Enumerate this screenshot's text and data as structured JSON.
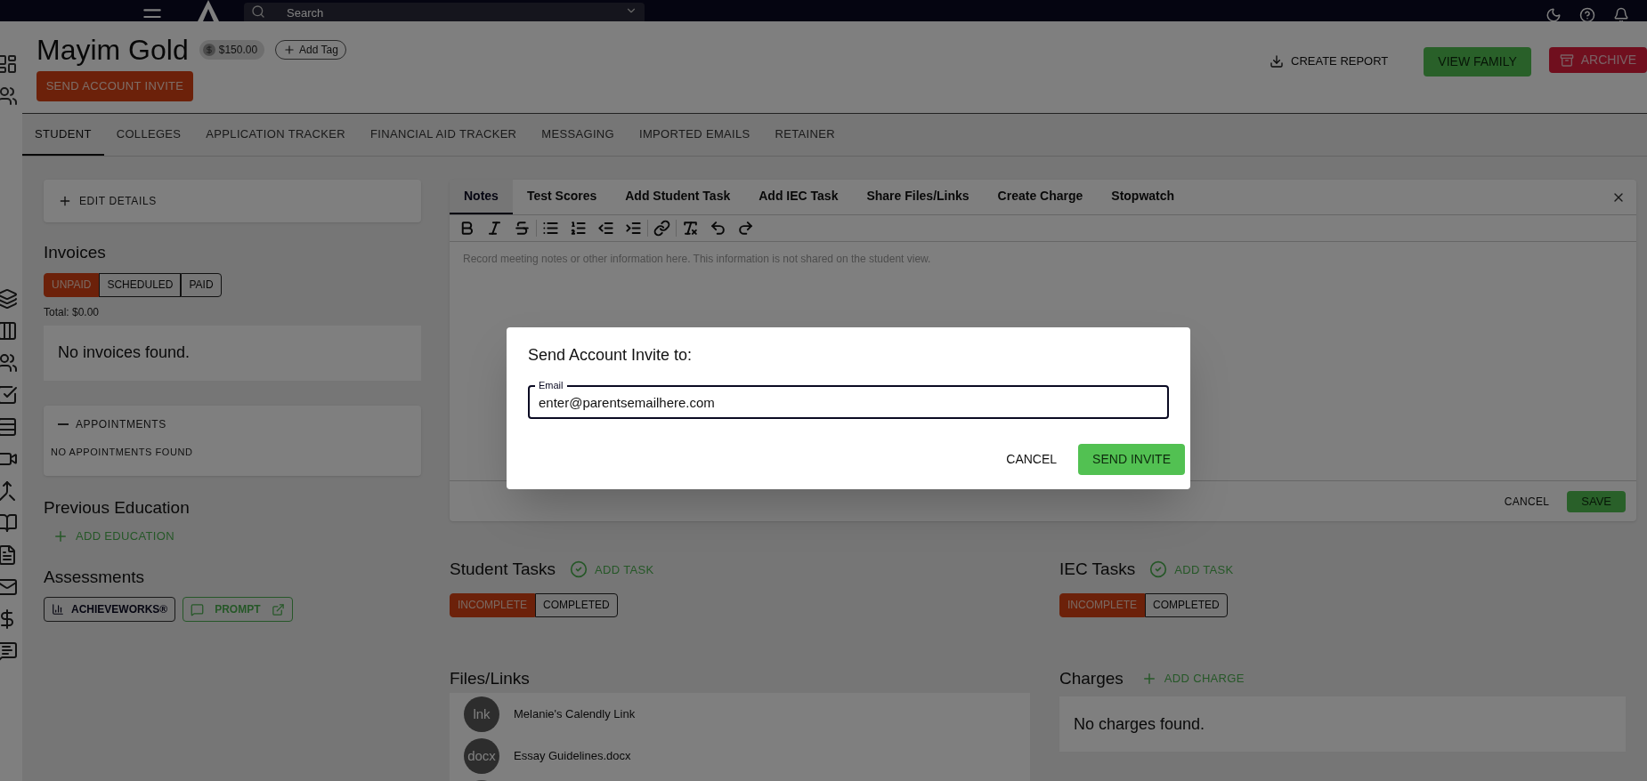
{
  "top_bar": {
    "search": {
      "placeholder": "Search"
    }
  },
  "student": {
    "name": "Mayim Gold",
    "balance": "$150.00",
    "add_tag": "Add Tag",
    "invite_button": "SEND ACCOUNT INVITE"
  },
  "header_actions": [
    {
      "label": "CREATE REPORT",
      "kind": "text"
    },
    {
      "label": "VIEW FAMILY",
      "kind": "success"
    },
    {
      "label": "ARCHIVE",
      "kind": "danger"
    }
  ],
  "tabs": [
    {
      "label": "STUDENT",
      "selected": true
    },
    {
      "label": "COLLEGES",
      "selected": false
    },
    {
      "label": "APPLICATION TRACKER",
      "selected": false
    },
    {
      "label": "FINANCIAL AID TRACKER",
      "selected": false
    },
    {
      "label": "MESSAGING",
      "selected": false
    },
    {
      "label": "IMPORTED EMAILS",
      "selected": false
    },
    {
      "label": "RETAINER",
      "selected": false
    }
  ],
  "edit_details": {
    "label": "EDIT DETAILS",
    "expanded": false
  },
  "invoices": {
    "title": "Invoices",
    "filters": [
      {
        "label": "UNPAID",
        "selected": true
      },
      {
        "label": "SCHEDULED",
        "selected": false
      },
      {
        "label": "PAID",
        "selected": false
      }
    ],
    "total": "Total: $0.00",
    "empty": "No invoices found."
  },
  "appointments": {
    "title": "APPOINTMENTS",
    "expanded": true,
    "empty": "NO APPOINTMENTS FOUND"
  },
  "previous_education": {
    "title": "Previous Education",
    "action": "ADD EDUCATION"
  },
  "assessments": {
    "title": "Assessments",
    "items": [
      {
        "label": "ACHIEVEWORKS®",
        "kind": "chart"
      },
      {
        "label": "PROMPT",
        "kind": "external"
      }
    ]
  },
  "notes_panel": {
    "tabs": [
      {
        "label": "Notes",
        "selected": true
      },
      {
        "label": "Test Scores",
        "selected": false
      },
      {
        "label": "Add Student Task",
        "selected": false
      },
      {
        "label": "Add IEC Task",
        "selected": false
      },
      {
        "label": "Share Files/Links",
        "selected": false
      },
      {
        "label": "Create Charge",
        "selected": false
      },
      {
        "label": "Stopwatch",
        "selected": false
      }
    ],
    "placeholder": "Record meeting notes or other information here. This information is not shared on the student view.",
    "actions": [
      {
        "label": "CANCEL",
        "kind": "text"
      },
      {
        "label": "SAVE",
        "kind": "primary"
      }
    ]
  },
  "student_tasks": {
    "title": "Student Tasks",
    "action": "ADD TASK",
    "filters": [
      {
        "label": "INCOMPLETE",
        "selected": true
      },
      {
        "label": "COMPLETED",
        "selected": false
      }
    ]
  },
  "iec_tasks": {
    "title": "IEC Tasks",
    "action": "ADD TASK",
    "filters": [
      {
        "label": "INCOMPLETE",
        "selected": true
      },
      {
        "label": "COMPLETED",
        "selected": false
      }
    ]
  },
  "files": {
    "title": "Files/Links",
    "items": [
      {
        "type": "lnk",
        "name": "Melanie's Calendly Link"
      },
      {
        "type": "docx",
        "name": "Essay Guidelines.docx"
      }
    ]
  },
  "charges": {
    "title": "Charges",
    "action": "ADD CHARGE",
    "empty": "No charges found."
  },
  "dialog": {
    "title": "Send Account Invite to:",
    "field": {
      "label": "Email",
      "value": "enter@parentsemailhere.com"
    },
    "buttons": [
      {
        "label": "CANCEL",
        "kind": "text"
      },
      {
        "label": "SEND INVITE",
        "kind": "primary"
      }
    ]
  }
}
